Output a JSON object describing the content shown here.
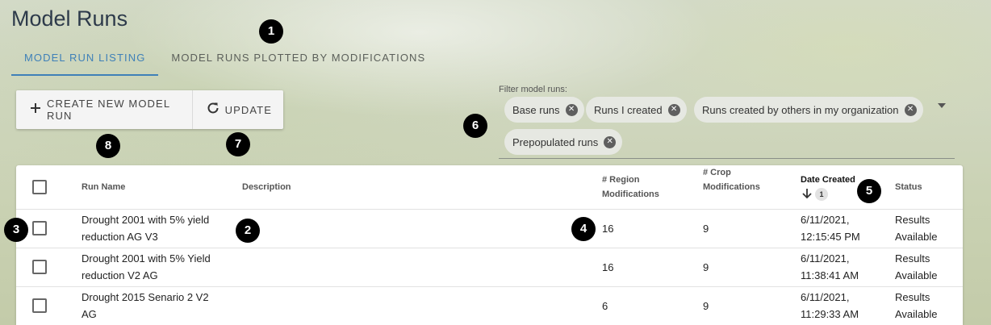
{
  "page": {
    "title": "Model Runs"
  },
  "tabs": [
    {
      "label": "MODEL RUN LISTING",
      "active": true
    },
    {
      "label": "MODEL RUNS PLOTTED BY MODIFICATIONS",
      "active": false
    }
  ],
  "toolbar": {
    "create_label": "CREATE NEW MODEL RUN",
    "update_label": "UPDATE"
  },
  "filter": {
    "label": "Filter model runs:",
    "chips": [
      "Base runs",
      "Runs I created",
      "Runs created by others in my organization",
      "Prepopulated runs"
    ]
  },
  "table": {
    "headers": {
      "run_name": "Run Name",
      "description": "Description",
      "region_mods": "# Region Modifications",
      "crop_mods": "# Crop Modifications",
      "date_created": "Date Created",
      "status": "Status"
    },
    "sort": {
      "direction": "descending",
      "order": "1"
    },
    "rows": [
      {
        "name": "Drought 2001 with 5% yield reduction AG V3",
        "description": "",
        "region_mods": "16",
        "crop_mods": "9",
        "date": "6/11/2021, 12:15:45 PM",
        "status": "Results Available"
      },
      {
        "name": "Drought 2001 with 5% Yield reduction V2 AG",
        "description": "",
        "region_mods": "16",
        "crop_mods": "9",
        "date": "6/11/2021, 11:38:41 AM",
        "status": "Results Available"
      },
      {
        "name": "Drought 2015 Senario 2 V2 AG",
        "description": "",
        "region_mods": "6",
        "crop_mods": "9",
        "date": "6/11/2021, 11:29:33 AM",
        "status": "Results Available"
      }
    ]
  },
  "markers": [
    "1",
    "2",
    "3",
    "4",
    "5",
    "6",
    "7",
    "8"
  ],
  "colors": {
    "accent": "#3f80b8",
    "marker": "#000000"
  }
}
